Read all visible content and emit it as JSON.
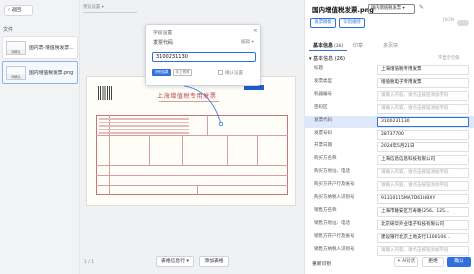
{
  "left": {
    "back_label": "返回",
    "files_label": "文件",
    "files": [
      {
        "name": "国内票-增值税发票...",
        "thumb_tag": "待确认",
        "selected": false
      },
      {
        "name": "国内增值税发票.png",
        "thumb_tag": "待确认",
        "selected": true
      }
    ]
  },
  "middle": {
    "view_select": "预览设置",
    "invoice_title": "上海增值税专用发票",
    "popup": {
      "title": "字段设置",
      "field_name": "发票代码",
      "edit_label": "编辑",
      "value": "3100231130",
      "tag_recognize": "识别结果",
      "tag_manual": "手工修改",
      "confirm_label": "确认设置"
    },
    "bottom_btn1": "表格信息行",
    "bottom_btn2": "添加表格",
    "pager": "1 / 1"
  },
  "right": {
    "title": "国内增值税发票.png",
    "title_tag": "国内增值税发票",
    "btn_export": "发票模板",
    "btn_template": "识别规则",
    "json_label": "JSON",
    "tabs": [
      "基本信息",
      "印章",
      "多页块"
    ],
    "tab_count": "(26)",
    "section_title": "基本信息 (26)",
    "section_right": "不显示空值",
    "fields": [
      {
        "label": "标题",
        "value": "上海增值税专用发票",
        "placeholder": false,
        "highlight": false
      },
      {
        "label": "发票类型",
        "value": "增值税电子专用发票",
        "placeholder": false,
        "highlight": false
      },
      {
        "label": "机器编号",
        "value": "请输入内容，请点击按钮添加字段",
        "placeholder": true,
        "highlight": false
      },
      {
        "label": "密码区",
        "value": "请输入内容，请点击按钮添加字段",
        "placeholder": true,
        "highlight": false
      },
      {
        "label": "发票代码",
        "value": "3100231130",
        "placeholder": false,
        "highlight": true
      },
      {
        "label": "发票号码",
        "value": "28737700",
        "placeholder": false,
        "highlight": false
      },
      {
        "label": "开票日期",
        "value": "2024年5月21日",
        "placeholder": false,
        "highlight": false
      },
      {
        "label": "购买方名称",
        "value": "上海信息信息科技有限公司",
        "placeholder": false,
        "highlight": false
      },
      {
        "label": "购买方地址、电话",
        "value": "请输入内容，请点击按钮添加字段",
        "placeholder": true,
        "highlight": false
      },
      {
        "label": "购买方开户行及账号",
        "value": "请输入内容，请点击按钮添加字段",
        "placeholder": true,
        "highlight": false
      },
      {
        "label": "购买方纳税人识别号",
        "value": "91310115MA7D61HBXY",
        "placeholder": false,
        "highlight": false
      },
      {
        "label": "销售方名称",
        "value": "上海市静安区万寿路(256、125...",
        "placeholder": false,
        "highlight": false
      },
      {
        "label": "销售方地址、电话",
        "value": "北京研华外业电子科技有限公司",
        "placeholder": false,
        "highlight": false
      },
      {
        "label": "销售方开户行及账号",
        "value": "建设银行北京上地支行1100104...",
        "placeholder": false,
        "highlight": false
      },
      {
        "label": "销售方纳税人识别号",
        "value": "请输入内容，请点击按钮添加字段",
        "placeholder": true,
        "highlight": false
      }
    ],
    "reset_label": "重新识别",
    "ai_label": "AI对话",
    "reject_label": "拒绝",
    "confirm_label": "确认"
  }
}
